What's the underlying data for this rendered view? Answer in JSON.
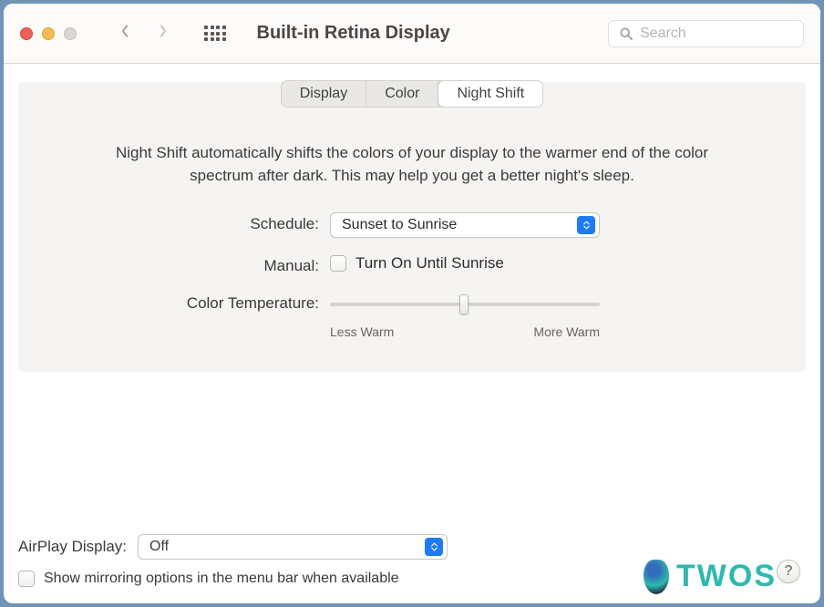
{
  "toolbar": {
    "title": "Built-in Retina Display",
    "search_placeholder": "Search"
  },
  "tabs": {
    "display": "Display",
    "color": "Color",
    "night_shift": "Night Shift",
    "selected_index": 2
  },
  "description": "Night Shift automatically shifts the colors of your display to the warmer end of the color spectrum after dark. This may help you get a better night's sleep.",
  "form": {
    "schedule_label": "Schedule:",
    "schedule_value": "Sunset to Sunrise",
    "manual_label": "Manual:",
    "manual_checkbox_label": "Turn On Until Sunrise",
    "manual_checked": false,
    "color_temp_label": "Color Temperature:",
    "slider_min_label": "Less Warm",
    "slider_max_label": "More Warm",
    "slider_value_percent": 48
  },
  "bottom": {
    "airplay_label": "AirPlay Display:",
    "airplay_value": "Off",
    "mirror_label": "Show mirroring options in the menu bar when available",
    "mirror_checked": false
  },
  "help": "?",
  "watermark": {
    "text": "TWOS"
  },
  "colors": {
    "accent": "#1e7bf6",
    "panel_bg": "#f5f4f2"
  }
}
